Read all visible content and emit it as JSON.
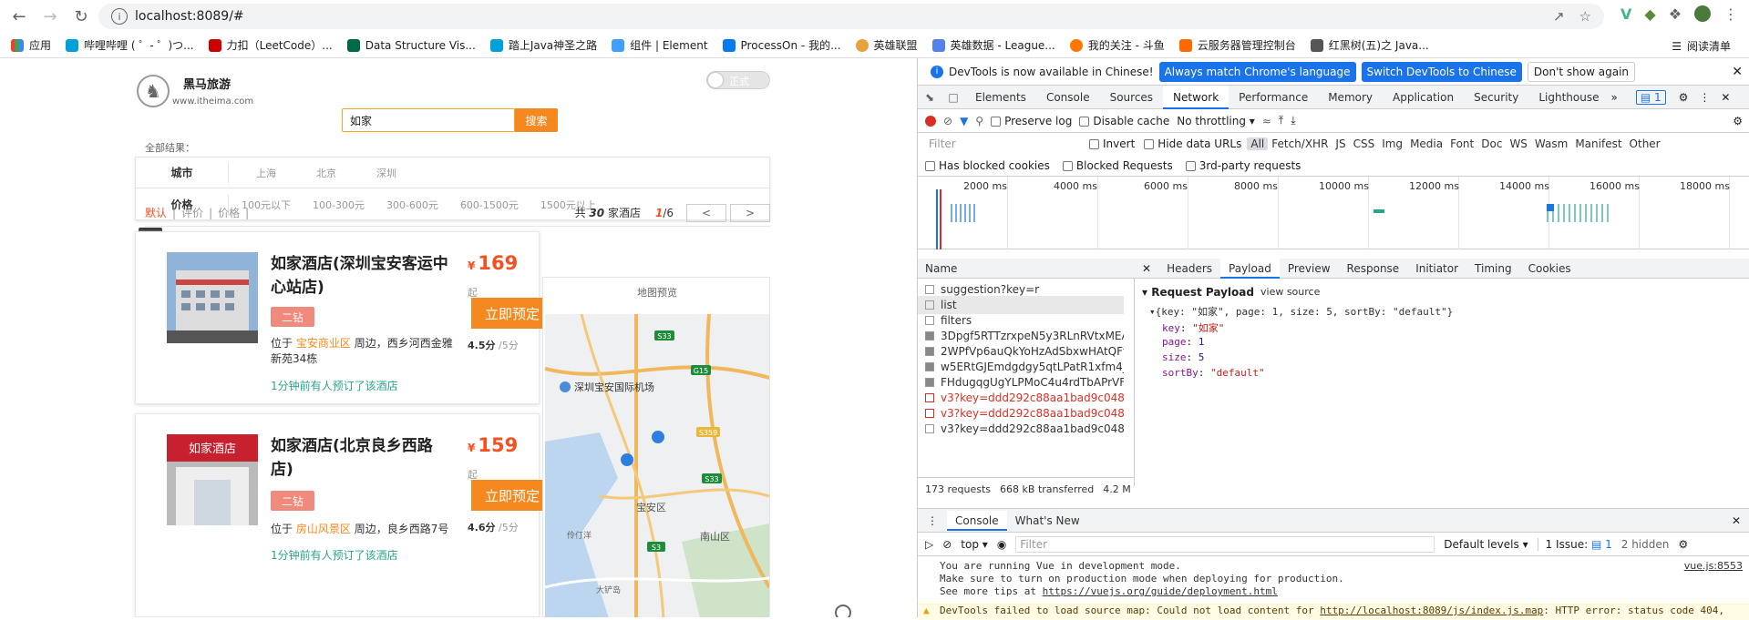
{
  "browser": {
    "url": "localhost:8089/#",
    "bookmarks": [
      "应用",
      "哔哩哔哩 ( ゜- ゜)つ...",
      "力扣（LeetCode）...",
      "Data Structure Vis...",
      "踏上Java神圣之路",
      "组件 | Element",
      "ProcessOn - 我的...",
      "英雄联盟",
      "英雄数据 - League...",
      "我的关注 - 斗鱼",
      "云服务器管理控制台",
      "红黑树(五)之 Java..."
    ],
    "reading_list": "阅读清单"
  },
  "site": {
    "brand": "黑马旅游",
    "url": "www.itheima.com",
    "toggle_label": "正式",
    "search_value": "如家",
    "search_button": "搜索",
    "all_results": "全部结果：",
    "filter": {
      "city_label": "城市",
      "cities": [
        "上海",
        "北京",
        "深圳"
      ],
      "price_label": "价格",
      "prices": [
        "100元以下",
        "100-300元",
        "300-600元",
        "600-1500元",
        "1500元以上"
      ]
    },
    "sort": {
      "default": "默认",
      "rating": "评价",
      "price": "价格",
      "total_prefix": "共",
      "total": "30",
      "total_suffix": "家酒店",
      "page_cur": "1",
      "page_total": "/6"
    },
    "map_label": "地图预览",
    "hotels": [
      {
        "name": "如家酒店(深圳宝安客运中心站店)",
        "tag": "二钻",
        "addr_pre": "位于",
        "area": "宝安商业区",
        "addr_post": "周边，西乡河西金雅新苑34栋",
        "booked": "1分钟前有人预订了该酒店",
        "currency": "¥",
        "price": "169",
        "qi": "起",
        "book_btn": "立即预定",
        "score": "4.5分",
        "score_max": "/5分"
      },
      {
        "name": "如家酒店(北京良乡西路店)",
        "tag": "二钻",
        "addr_pre": "位于",
        "area": "房山风景区",
        "addr_post": "周边，良乡西路7号",
        "booked": "1分钟前有人预订了该酒店",
        "currency": "¥",
        "price": "159",
        "qi": "起",
        "book_btn": "立即预定",
        "score": "4.6分",
        "score_max": "/5分"
      }
    ],
    "map_labels": {
      "airport": "深圳宝安国际机场",
      "district1": "宝安区",
      "district2": "南山区",
      "place1": "大铲岛",
      "place2": "伶仃洋",
      "road1": "S33",
      "road2": "G15",
      "road3": "S359",
      "road4": "S3",
      "road5": "S33"
    }
  },
  "devtools": {
    "info": "DevTools is now available in Chinese!",
    "btn_match": "Always match Chrome's language",
    "btn_switch": "Switch DevTools to Chinese",
    "btn_dont": "Don't show again",
    "tabs": [
      "Elements",
      "Console",
      "Sources",
      "Network",
      "Performance",
      "Memory",
      "Application",
      "Security",
      "Lighthouse"
    ],
    "issues_count": "1",
    "preserve_log": "Preserve log",
    "disable_cache": "Disable cache",
    "throttling": "No throttling",
    "filter_placeholder": "Filter",
    "invert": "Invert",
    "hide_data": "Hide data URLs",
    "types": [
      "All",
      "Fetch/XHR",
      "JS",
      "CSS",
      "Img",
      "Media",
      "Font",
      "Doc",
      "WS",
      "Wasm",
      "Manifest",
      "Other"
    ],
    "blocked_cookies": "Has blocked cookies",
    "blocked_requests": "Blocked Requests",
    "third_party": "3rd-party requests",
    "ticks": [
      "2000 ms",
      "4000 ms",
      "6000 ms",
      "8000 ms",
      "10000 ms",
      "12000 ms",
      "14000 ms",
      "16000 ms",
      "18000 ms"
    ],
    "name_header": "Name",
    "requests": [
      {
        "name": "suggestion?key=r",
        "err": false
      },
      {
        "name": "list",
        "err": false
      },
      {
        "name": "filters",
        "err": false
      },
      {
        "name": "3Dpgf5RTTzrxpeN5y3RLnRVtxMEA_w2",
        "err": false
      },
      {
        "name": "2WPfVp6auQkYoHzAdSbxwHAtQFfa_...",
        "err": false
      },
      {
        "name": "w5ERtGJEmdgdgy5qtLPatR1xfm4_w20",
        "err": false
      },
      {
        "name": "FHdugqgUgYLPMoC4u4rdTbAPrVF_w",
        "err": false
      },
      {
        "name": "v3?key=ddd292c88aa1bad9c04891",
        "err": true
      },
      {
        "name": "v3?key=ddd292c88aa1bad9c04891",
        "err": true
      },
      {
        "name": "v3?key=ddd292c88aa1bad9c04891",
        "err": false
      }
    ],
    "req_count": "173 requests",
    "transferred": "668 kB transferred",
    "size": "4.2 M",
    "detail_tabs": [
      "Headers",
      "Payload",
      "Preview",
      "Response",
      "Initiator",
      "Timing",
      "Cookies"
    ],
    "payload_title": "Request Payload",
    "view_source": "view source",
    "payload_summary": "{key: \"如家\", page: 1, size: 5, sortBy: \"default\"}",
    "payload": [
      {
        "k": "key",
        "v": "\"如家\"",
        "str": true
      },
      {
        "k": "page",
        "v": "1",
        "str": false
      },
      {
        "k": "size",
        "v": "5",
        "str": false
      },
      {
        "k": "sortBy",
        "v": "\"default\"",
        "str": true
      }
    ],
    "console_tabs": [
      "Console",
      "What's New"
    ],
    "context": "top",
    "console_filter": "Filter",
    "levels": "Default levels",
    "issues": "1 Issue:",
    "hidden": "2 hidden",
    "console_lines": [
      "You are running Vue in development mode.",
      "Make sure to turn on production mode when deploying for production.",
      "See more tips at "
    ],
    "console_link": "https://vuejs.org/guide/deployment.html",
    "console_source": "vue.js:8553",
    "warn_pre": "DevTools failed to load source map: Could not load content for ",
    "warn_link": "http://localhost:8089/js/index.js.map",
    "warn_post": ": HTTP error: status code 404,"
  }
}
